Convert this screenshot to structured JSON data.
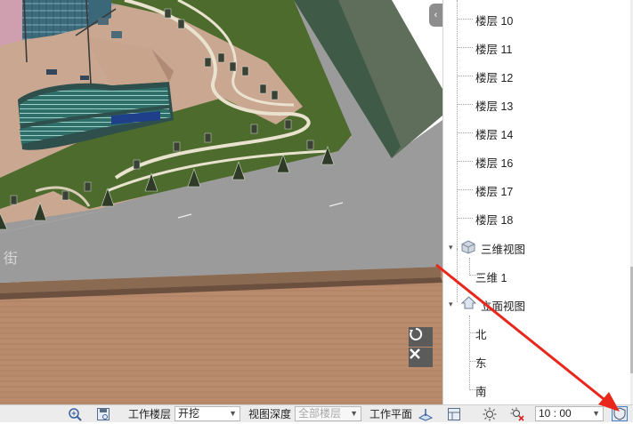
{
  "tree": {
    "floors": [
      "楼层 10",
      "楼层 11",
      "楼层 12",
      "楼层 13",
      "楼层 14",
      "楼层 16",
      "楼层 17",
      "楼层 18"
    ],
    "view3d_group": "三维视图",
    "view3d_items": [
      "三维 1"
    ],
    "elevation_group": "立面视图",
    "elevation_items": [
      "北",
      "东",
      "南"
    ]
  },
  "viewport": {
    "rotate_icon": "rotate-view-icon",
    "close_icon": "close-icon",
    "toggle_icon": "collapse-panel-icon",
    "ground_text": "街"
  },
  "statusbar": {
    "work_floor_label": "工作楼层",
    "work_floor_value": "开挖",
    "view_depth_label": "视图深度",
    "view_depth_value": "全部楼层",
    "work_plane_label": "工作平面",
    "time_value": "10 : 00"
  },
  "colors": {
    "annotation_arrow": "#e8261c",
    "lawn": "#4d6b2c",
    "road": "#9a9a9a",
    "plaza": "#c49f88",
    "terrain": "#b88a6c"
  }
}
